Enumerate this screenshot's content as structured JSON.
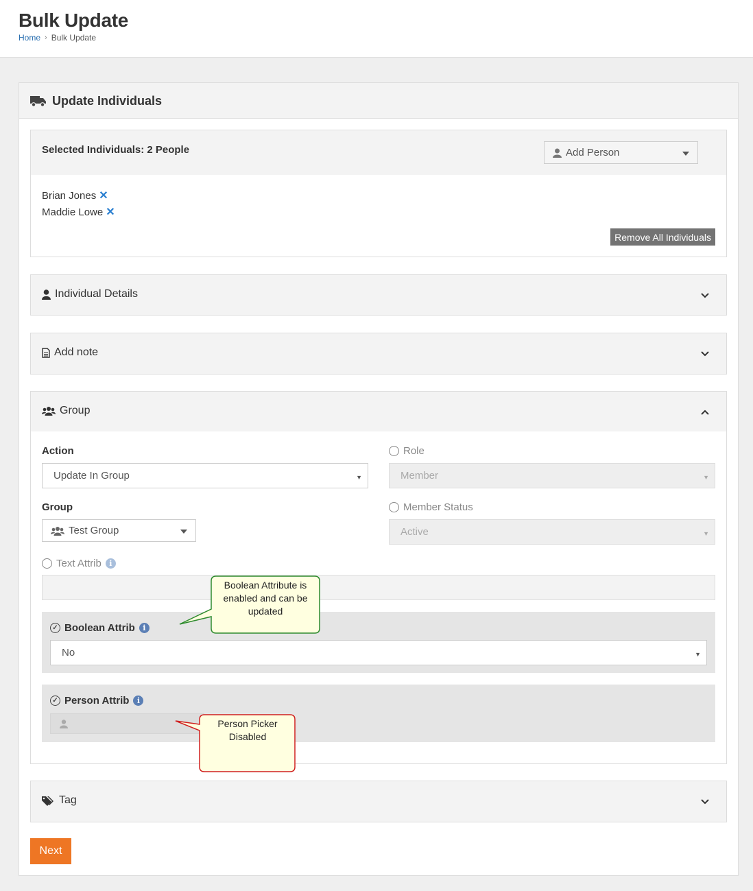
{
  "page": {
    "title": "Bulk Update"
  },
  "breadcrumb": {
    "home": "Home",
    "current": "Bulk Update"
  },
  "card": {
    "title": "Update Individuals"
  },
  "selected": {
    "title": "Selected Individuals: 2 People",
    "add_person": "Add Person",
    "people": [
      "Brian Jones",
      "Maddie Lowe"
    ],
    "remove_all": "Remove All Individuals"
  },
  "sections": {
    "individual_details": "Individual Details",
    "add_note": "Add note",
    "group": "Group",
    "tag": "Tag"
  },
  "group_form": {
    "action_label": "Action",
    "action_value": "Update In Group",
    "role_label": "Role",
    "role_value": "Member",
    "group_label": "Group",
    "group_value": "Test Group",
    "member_status_label": "Member Status",
    "member_status_value": "Active",
    "text_attrib_label": "Text Attrib",
    "boolean_attrib_label": "Boolean Attrib",
    "boolean_attrib_value": "No",
    "person_attrib_label": "Person Attrib"
  },
  "callouts": {
    "boolean": "Boolean Attribute is enabled and can be updated",
    "person": "Person Picker Disabled"
  },
  "footer": {
    "next": "Next"
  },
  "colors": {
    "primary_button": "#ee7624",
    "link": "#2a6fb0",
    "remove_icon": "#2a7fd0",
    "callout_fill": "#ffffe0",
    "callout_green": "#2e8b2e",
    "callout_red": "#d02020"
  },
  "icons": {
    "card": "truck-icon",
    "add_person": "user-icon",
    "individual_details": "user-icon",
    "add_note": "file-icon",
    "group": "users-icon",
    "tag": "tags-icon"
  }
}
